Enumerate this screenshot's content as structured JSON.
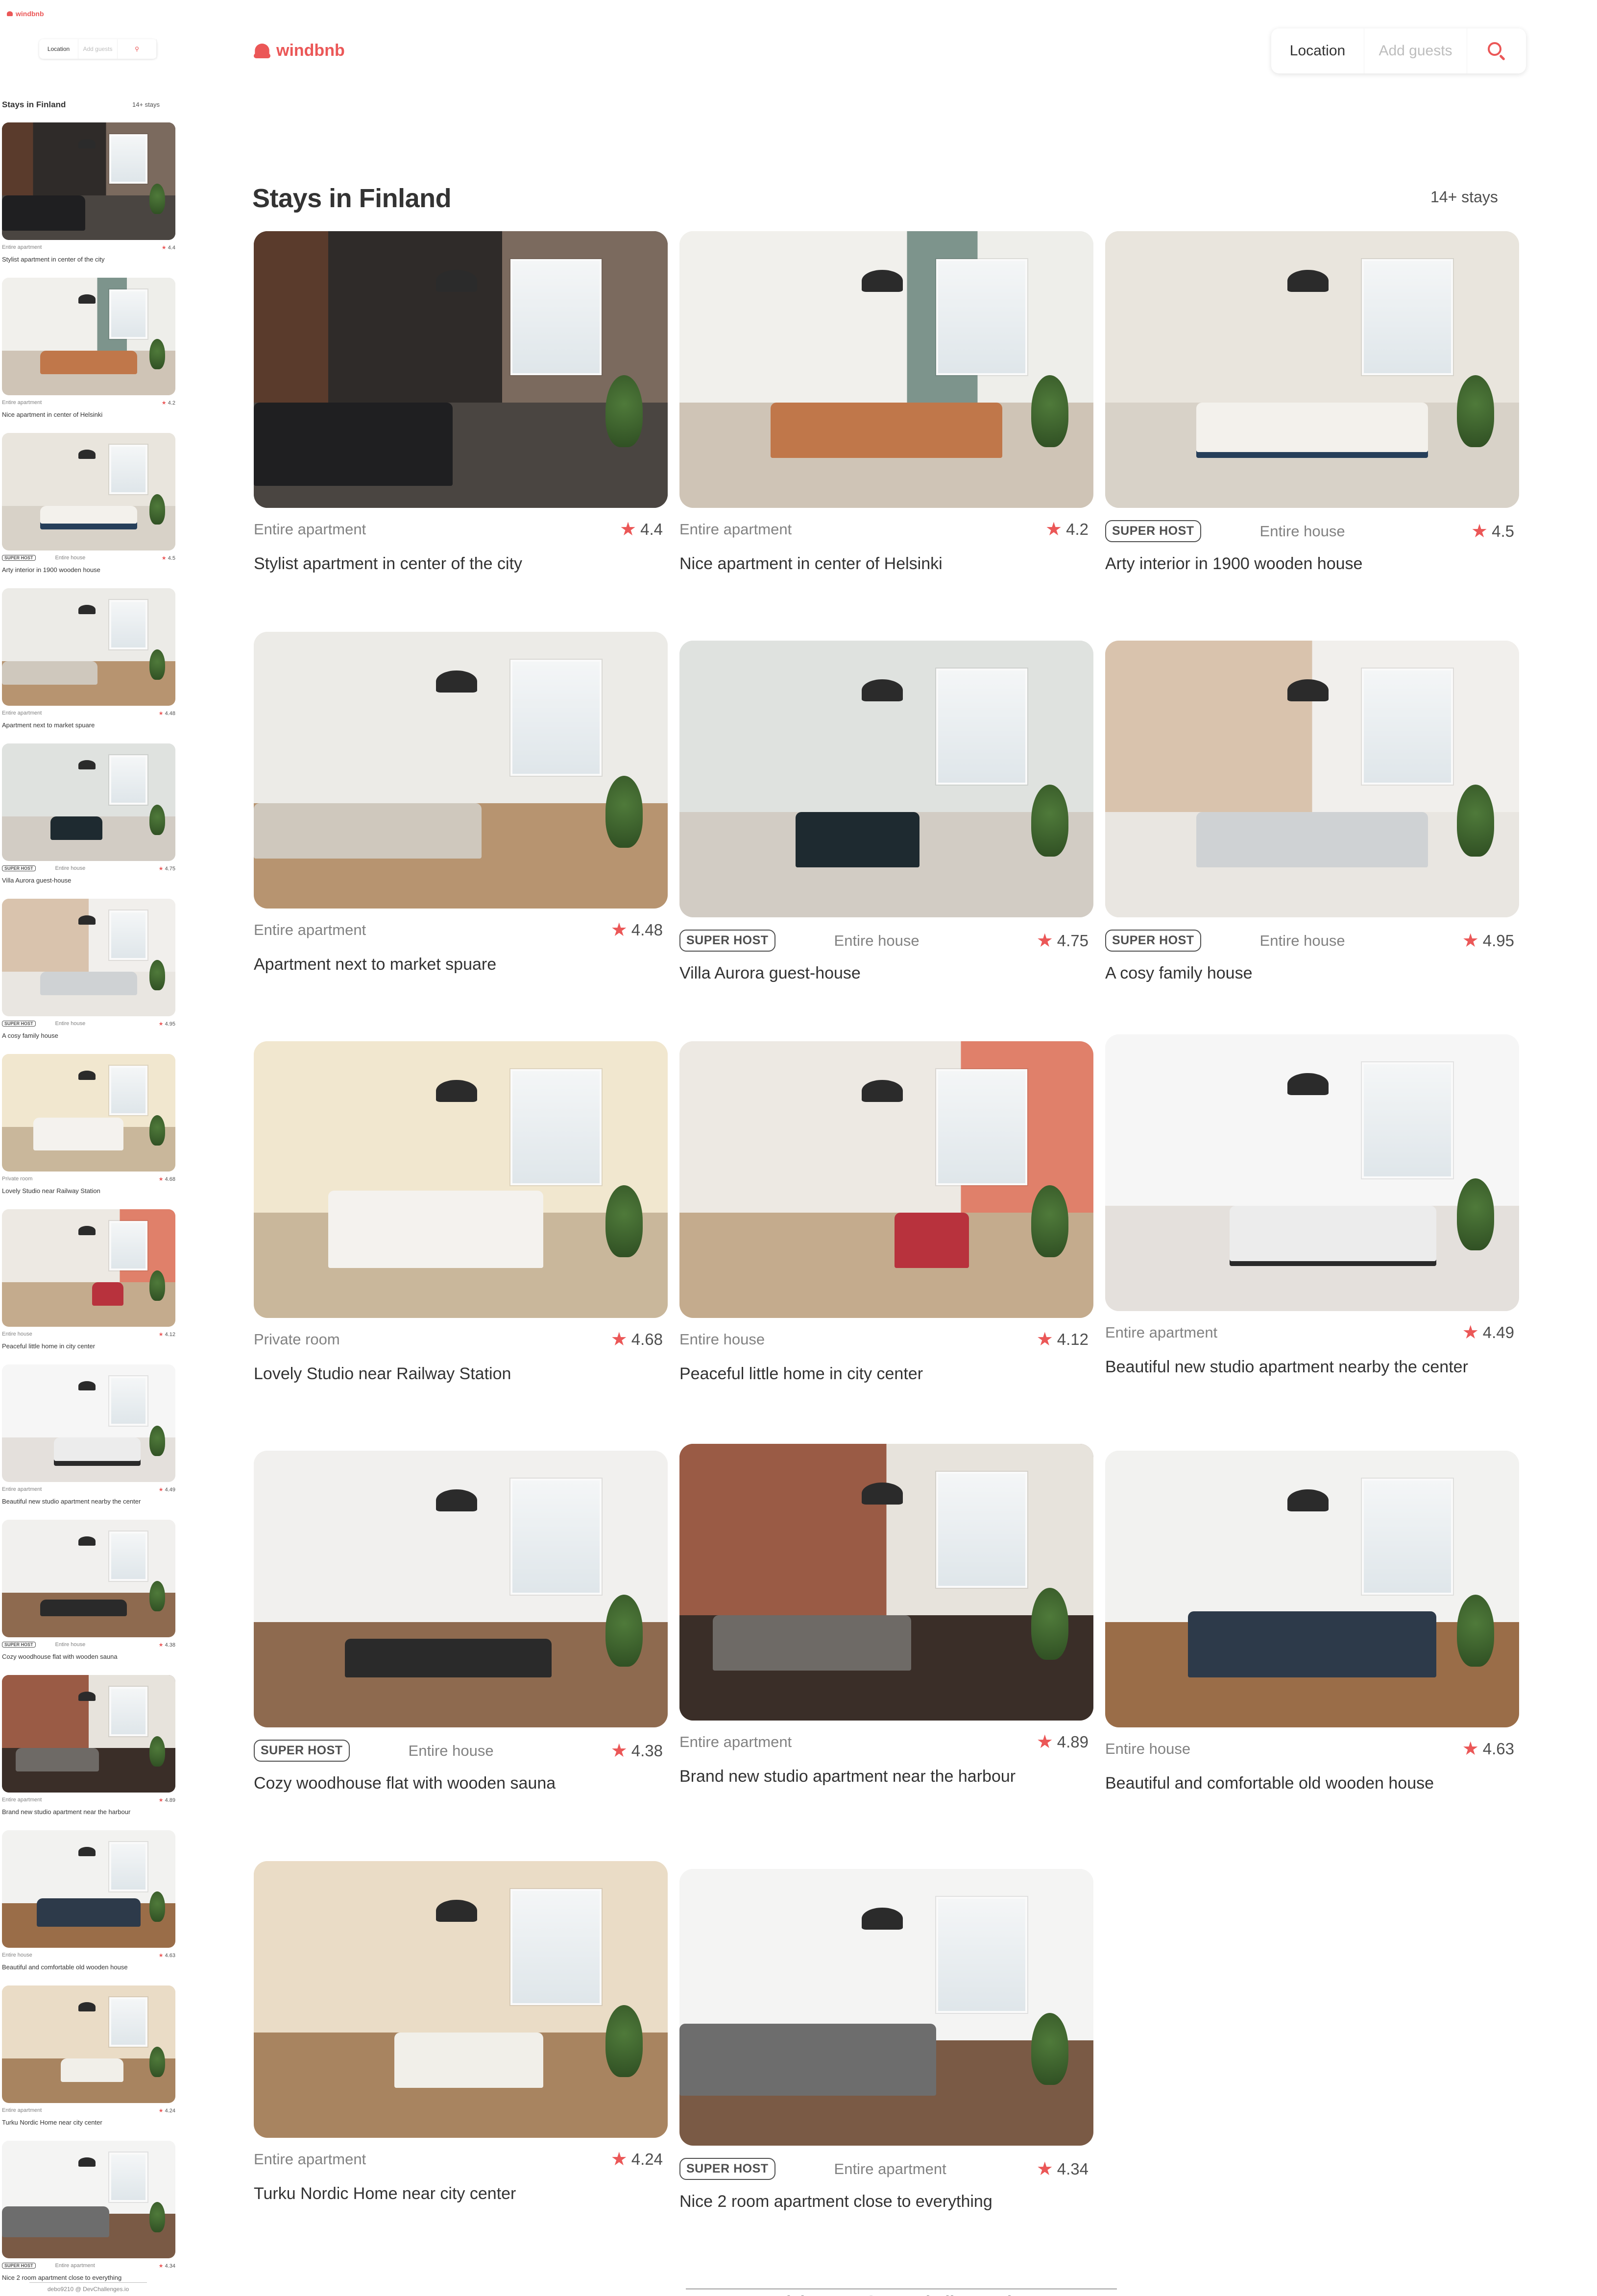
{
  "brand": {
    "name": "windbnb",
    "accent": "#EB5757"
  },
  "search": {
    "location": "Location",
    "guests_placeholder": "Add guests"
  },
  "heading": {
    "title": "Stays in Finland",
    "count": "14+ stays"
  },
  "stays": [
    {
      "type": "Entire apartment",
      "rating": "4.4",
      "superhost": false,
      "title": "Stylist apartment in center of the city"
    },
    {
      "type": "Entire apartment",
      "rating": "4.2",
      "superhost": false,
      "title": "Nice apartment in center of Helsinki"
    },
    {
      "type": "Entire house",
      "rating": "4.5",
      "superhost": true,
      "title": "Arty interior in 1900 wooden house"
    },
    {
      "type": "Entire apartment",
      "rating": "4.48",
      "superhost": false,
      "title": "Apartment next to market spuare"
    },
    {
      "type": "Entire house",
      "rating": "4.75",
      "superhost": true,
      "title": "Villa Aurora guest-house"
    },
    {
      "type": "Entire house",
      "rating": "4.95",
      "superhost": true,
      "title": "A cosy family house"
    },
    {
      "type": "Private room",
      "rating": "4.68",
      "superhost": false,
      "title": "Lovely Studio near Railway Station"
    },
    {
      "type": "Entire house",
      "rating": "4.12",
      "superhost": false,
      "title": "Peaceful little home in city center"
    },
    {
      "type": "Entire apartment",
      "rating": "4.49",
      "superhost": false,
      "title": "Beautiful new studio apartment nearby the center"
    },
    {
      "type": "Entire house",
      "rating": "4.38",
      "superhost": true,
      "title": "Cozy woodhouse flat with wooden sauna"
    },
    {
      "type": "Entire apartment",
      "rating": "4.89",
      "superhost": false,
      "title": "Brand new studio apartment near the harbour"
    },
    {
      "type": "Entire house",
      "rating": "4.63",
      "superhost": false,
      "title": "Beautiful and comfortable old wooden house"
    },
    {
      "type": "Entire apartment",
      "rating": "4.24",
      "superhost": false,
      "title": "Turku Nordic Home near city center"
    },
    {
      "type": "Entire apartment",
      "rating": "4.34",
      "superhost": true,
      "title": "Nice 2 room apartment close to everything"
    }
  ],
  "labels": {
    "superhost": "SUPER HOST"
  },
  "footer": {
    "credit": "debo9210 @ DevChallenges.io"
  }
}
